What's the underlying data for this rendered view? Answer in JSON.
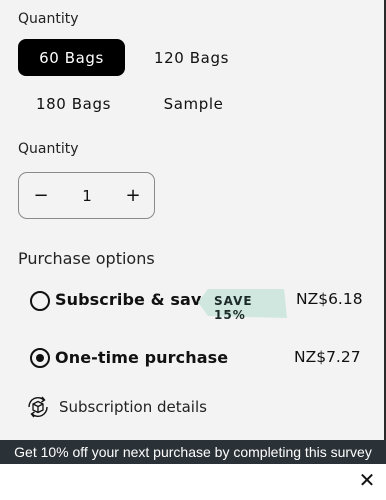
{
  "size_section": {
    "label": "Quantity",
    "options": [
      {
        "label": "60 Bags",
        "selected": true
      },
      {
        "label": "120 Bags",
        "selected": false
      },
      {
        "label": "180 Bags",
        "selected": false
      },
      {
        "label": "Sample",
        "selected": false
      }
    ]
  },
  "quantity_section": {
    "label": "Quantity",
    "decrement_icon": "minus-icon",
    "increment_icon": "plus-icon",
    "value": "1",
    "decrement_glyph": "−",
    "increment_glyph": "+"
  },
  "purchase_options": {
    "heading": "Purchase options",
    "subscribe": {
      "label": "Subscribe & save",
      "badge": "SAVE 15%",
      "badge_color": "#cfe7df",
      "price": "NZ$6.18",
      "selected": false
    },
    "one_time": {
      "label": "One-time purchase",
      "price": "NZ$7.27",
      "selected": true
    },
    "details_link": {
      "label": "Subscription details",
      "icon": "subscription-box-icon"
    }
  },
  "survey_banner": {
    "text": "Get 10% off your next purchase by completing this survey",
    "background": "#2b3237"
  },
  "close_button": {
    "icon": "close-icon",
    "glyph": "✕"
  }
}
